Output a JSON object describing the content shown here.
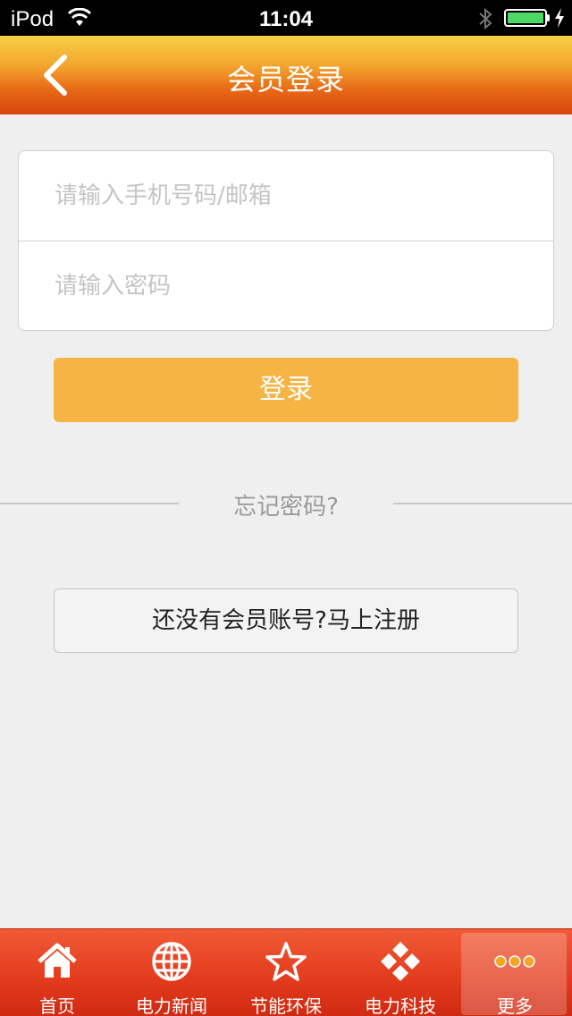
{
  "status_bar": {
    "carrier": "iPod",
    "time": "11:04",
    "battery_level": 1.0,
    "battery_color": "#4cd964",
    "icons": [
      "wifi-icon",
      "bluetooth-icon",
      "battery-icon",
      "charging-icon"
    ]
  },
  "nav": {
    "title": "会员登录",
    "back_icon": "chevron-left-icon"
  },
  "form": {
    "account_placeholder": "请输入手机号码/邮箱",
    "account_value": "",
    "password_placeholder": "请输入密码",
    "password_value": ""
  },
  "login_button_label": "登录",
  "forgot_password_label": "忘记密码?",
  "register_button_label": "还没有会员账号?马上注册",
  "tabs": [
    {
      "label": "首页",
      "icon": "home-icon"
    },
    {
      "label": "电力新闻",
      "icon": "globe-icon"
    },
    {
      "label": "节能环保",
      "icon": "star-icon"
    },
    {
      "label": "电力科技",
      "icon": "diamond-grid-icon"
    },
    {
      "label": "更多",
      "icon": "more-dots-icon",
      "active": true
    }
  ],
  "colors": {
    "accent": "#f5b444",
    "tab_bar": "#e23a1d",
    "nav_gradient_top": "#f8cf46",
    "nav_gradient_bottom": "#d8430c",
    "more_dots": "#f5a623"
  }
}
